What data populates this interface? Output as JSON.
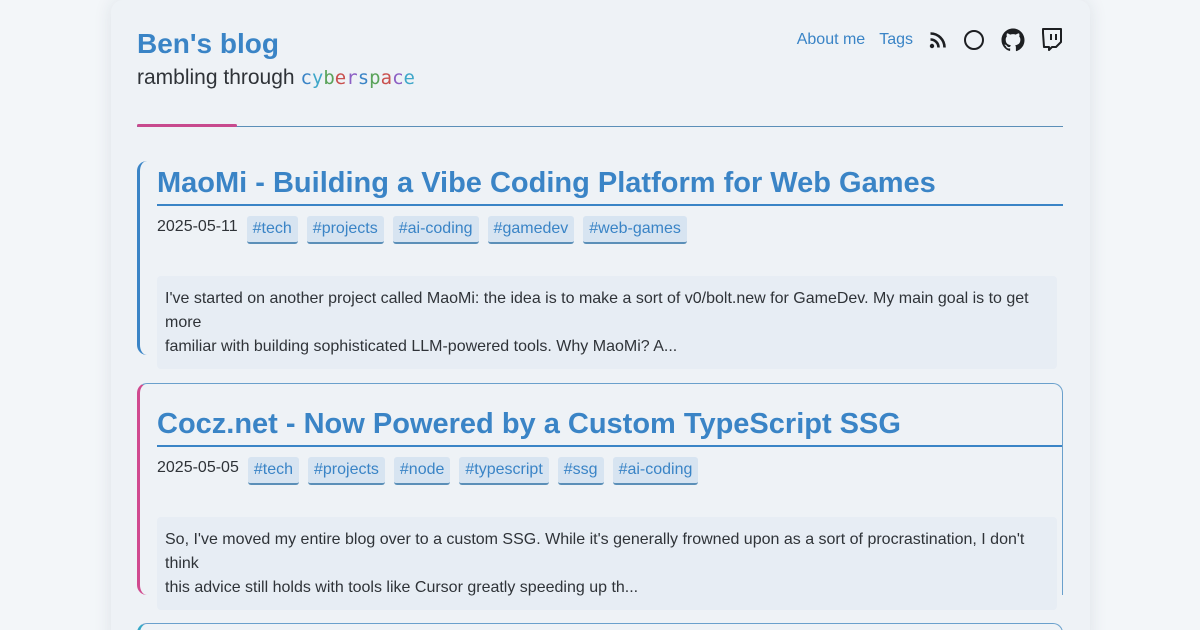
{
  "site": {
    "title": "Ben's blog",
    "subtitle_prefix": "rambling through",
    "subtitle_highlight": [
      "c",
      "y",
      "b",
      "e",
      "r",
      "s",
      "p",
      "a",
      "c",
      "e"
    ],
    "highlight_colors": [
      "#3a84c6",
      "#3fa7c9",
      "#5aa35a",
      "#c9504e",
      "#8c5fc4",
      "#3a84c6",
      "#5aa35a",
      "#c9504e",
      "#8c5fc4",
      "#3fa7c9"
    ]
  },
  "nav": {
    "about": "About me",
    "tags": "Tags",
    "icons": [
      "rss-icon",
      "circle-icon",
      "github-icon",
      "twitch-icon"
    ]
  },
  "posts": [
    {
      "title": "MaoMi - Building a Vibe Coding Platform for Web Games",
      "date": "2025-05-11",
      "tags": [
        "#tech",
        "#projects",
        "#ai-coding",
        "#gamedev",
        "#web-games"
      ],
      "excerpt_line1": "I've started on another project called MaoMi: the idea is to make a sort of v0/bolt.new for GameDev. My main goal is to get more",
      "excerpt_line2": "familiar with building sophisticated LLM-powered tools. Why MaoMi? A..."
    },
    {
      "title": "Cocz.net - Now Powered by a Custom TypeScript SSG",
      "date": "2025-05-05",
      "tags": [
        "#tech",
        "#projects",
        "#node",
        "#typescript",
        "#ssg",
        "#ai-coding"
      ],
      "excerpt_line1": "So, I've moved my entire blog over to a custom SSG. While it's generally frowned upon as a sort of procrastination, I don't think",
      "excerpt_line2": "this advice still holds with tools like Cursor greatly speeding up th..."
    }
  ],
  "colors": {
    "accent": "#3a84c6",
    "pink": "#d04a8f",
    "background": "#f3f6f9"
  }
}
